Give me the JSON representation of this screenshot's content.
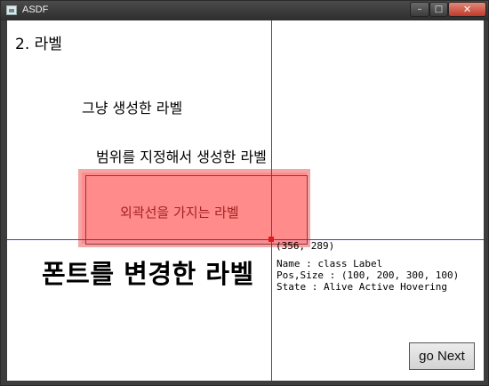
{
  "window": {
    "title": "ASDF",
    "controls": {
      "minimize": "–",
      "maximize": "□",
      "close": "✕"
    }
  },
  "scene": {
    "title": "2. 라벨",
    "labels": {
      "plain": "그냥 생성한 라벨",
      "ranged": "범위를 지정해서 생성한 라벨",
      "outlined": "외곽선을 가지는 라벨",
      "font": "폰트를 변경한 라벨"
    },
    "outline_colors": {
      "fill": "#ff8b8b",
      "border": "#f2a6a6",
      "text": "#a42222"
    }
  },
  "debug": {
    "cursor_readout": "(356, 289)",
    "name_line": "Name : class Label",
    "pos_size_line": "Pos,Size : (100, 200, 300, 100)",
    "state_line": "State : Alive Active Hovering",
    "crosshair_color": "#3e3ecf",
    "marker_color": "#e01a1a"
  },
  "buttons": {
    "next_label": "go Next"
  }
}
